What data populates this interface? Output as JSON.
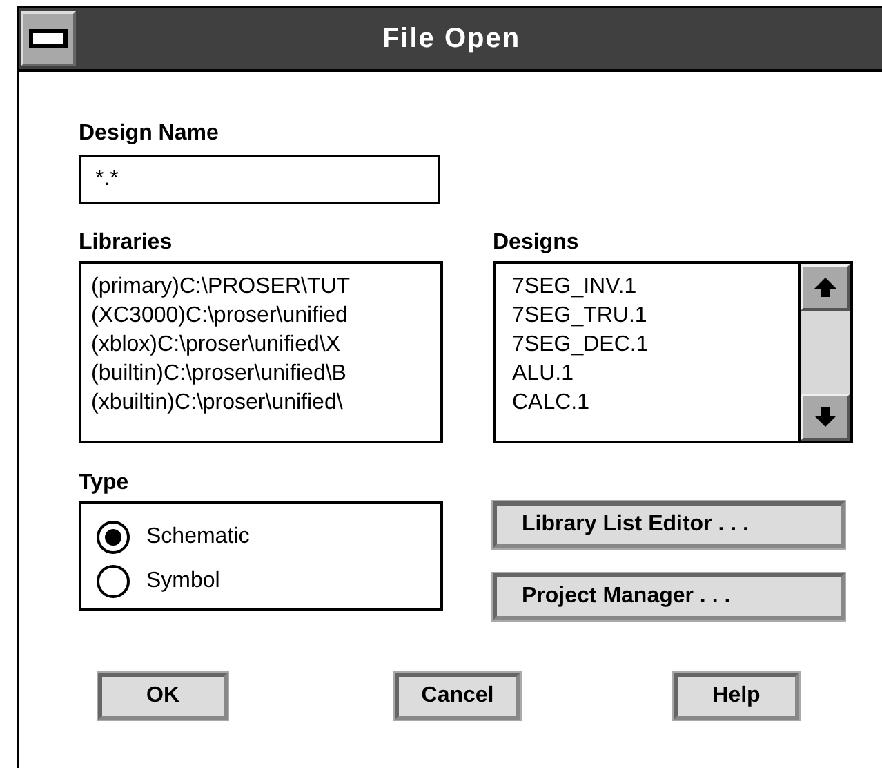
{
  "window": {
    "title": "File Open"
  },
  "design_name": {
    "label": "Design Name",
    "value": "*.*"
  },
  "libraries": {
    "label": "Libraries",
    "items": [
      {
        "text": "(primary)C:\\PROSER\\TUT"
      },
      {
        "text": "(XC3000)C:\\proser\\unified"
      },
      {
        "text": "(xblox)C:\\proser\\unified\\X"
      },
      {
        "text": "(builtin)C:\\proser\\unified\\B"
      },
      {
        "text": "(xbuiltin)C:\\proser\\unified\\"
      }
    ]
  },
  "designs": {
    "label": "Designs",
    "items": [
      {
        "text": "7SEG_INV.1"
      },
      {
        "text": "7SEG_TRU.1"
      },
      {
        "text": "7SEG_DEC.1"
      },
      {
        "text": "ALU.1"
      },
      {
        "text": "CALC.1"
      }
    ]
  },
  "type": {
    "label": "Type",
    "options": [
      {
        "label": "Schematic",
        "selected": true
      },
      {
        "label": "Symbol",
        "selected": false
      }
    ]
  },
  "side_buttons": [
    "Library List Editor . . .",
    "Project Manager . . ."
  ],
  "buttons": [
    "OK",
    "Cancel",
    "Help"
  ]
}
